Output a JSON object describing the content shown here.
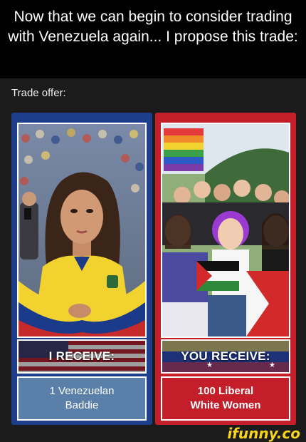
{
  "header": {
    "title": "Now that we can begin to consider trading with Venezuela again... I propose this trade:"
  },
  "trade": {
    "label": "Trade offer:",
    "left": {
      "banner": "I RECEIVE:",
      "caption_line1": "1 Venezuelan",
      "caption_line2": "Baddie"
    },
    "right": {
      "banner": "YOU RECEIVE:",
      "caption_line1": "100 Liberal",
      "caption_line2": "White Women"
    }
  },
  "watermark": {
    "text": "ifunny.co"
  },
  "colors": {
    "left_panel": "#1e3d8a",
    "right_panel": "#c41e2b",
    "left_caption": "#5a7fa8",
    "watermark": "#f7d417"
  }
}
